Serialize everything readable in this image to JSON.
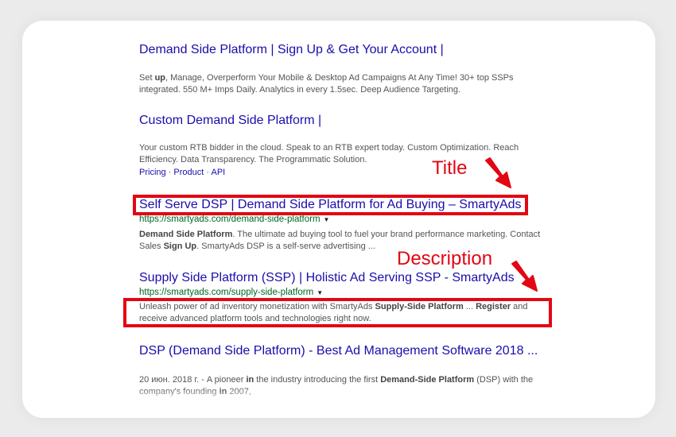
{
  "results": [
    {
      "title": "Demand Side Platform | Sign Up & Get Your Account |",
      "snippet_parts": [
        {
          "t": "Set ",
          "b": false
        },
        {
          "t": "up",
          "b": true
        },
        {
          "t": ", Manage, Overperform Your Mobile & Desktop Ad Campaigns At Any Time! 30+ top SSPs integrated. 550 M+ Imps Daily. Analytics in every 1.5sec. Deep Audience Targeting.",
          "b": false
        }
      ]
    },
    {
      "title": "Custom Demand Side Platform |",
      "snippet_parts": [
        {
          "t": "Your custom RTB bidder in the cloud. Speak to an RTB expert today. Custom Optimization. Reach Efficiency. Data Transparency. The Programmatic Solution.",
          "b": false
        }
      ],
      "sitelinks": [
        "Pricing",
        "Product",
        "API"
      ],
      "sitelink_sep": " · "
    },
    {
      "title": "Self Serve DSP | Demand Side Platform for Ad Buying – SmartyAds",
      "url": "https://smartyads.com/demand-side-platform",
      "snippet_parts": [
        {
          "t": "Demand Side Platform",
          "b": true
        },
        {
          "t": ". The ultimate ad buying tool to fuel your brand performance marketing. Contact Sales ",
          "b": false
        },
        {
          "t": "Sign Up",
          "b": true
        },
        {
          "t": ". SmartyAds DSP is a self-serve advertising ...",
          "b": false
        }
      ]
    },
    {
      "title": "Supply Side Platform (SSP) | Holistic Ad Serving SSP - SmartyAds",
      "url": "https://smartyads.com/supply-side-platform",
      "snippet_parts": [
        {
          "t": "Unleash power of ad inventory monetization with SmartyAds ",
          "b": false
        },
        {
          "t": "Supply-Side Platform",
          "b": true
        },
        {
          "t": " ... ",
          "b": false
        },
        {
          "t": "Register",
          "b": true
        },
        {
          "t": " and receive advanced platform tools and technologies right now.",
          "b": false
        }
      ]
    },
    {
      "title": "DSP (Demand Side Platform) - Best Ad Management Software 2018 ...",
      "snippet_parts": [
        {
          "t": "20 июн. 2018 г. - A pioneer ",
          "b": false
        },
        {
          "t": "in",
          "b": true
        },
        {
          "t": " the industry introducing the first ",
          "b": false
        },
        {
          "t": "Demand-Side Platform",
          "b": true
        },
        {
          "t": " (DSP) with the company's founding ",
          "b": false
        },
        {
          "t": "in",
          "b": true
        },
        {
          "t": " 2007,",
          "b": false
        }
      ]
    }
  ],
  "annotations": {
    "title_label": "Title",
    "description_label": "Description"
  },
  "colors": {
    "link": "#1a0dab",
    "url": "#006621",
    "snippet": "#545454",
    "highlight": "#e30613"
  }
}
